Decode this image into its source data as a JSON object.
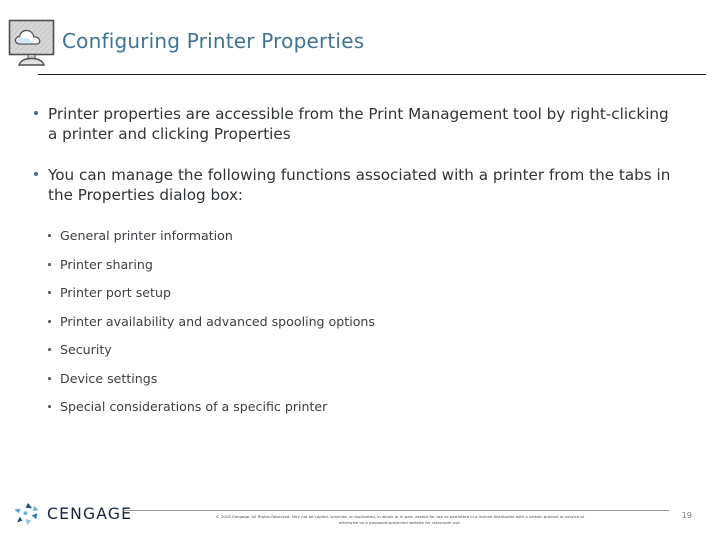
{
  "slide": {
    "header": {
      "icon": "monitor-cloud-icon",
      "title": "Configuring Printer Properties",
      "title_color": "#3f7492"
    },
    "content": {
      "bullets": [
        {
          "text": "Printer properties are accessible from the Print Management tool by right-clicking a printer and clicking Properties"
        },
        {
          "text": "You can manage the following functions associated with a printer from the tabs in the Properties dialog box:"
        }
      ],
      "sub_bullets": [
        "General printer information",
        "Printer sharing",
        "Printer port setup",
        "Printer availability and advanced spooling options",
        "Security",
        "Device settings",
        "Special considerations of a specific printer"
      ]
    },
    "footer": {
      "logo_text": "CENGAGE",
      "logo_mark": "cengage-pinwheel-icon",
      "copyright_line_1": "© 2018 Cengage. All Rights Reserved. May not be copied, scanned, or duplicated, in whole or in part, except for use as permitted in a license distributed with a certain product or service or",
      "copyright_line_2": "otherwise on a password-protected website for classroom use.",
      "page_number": "19"
    }
  }
}
